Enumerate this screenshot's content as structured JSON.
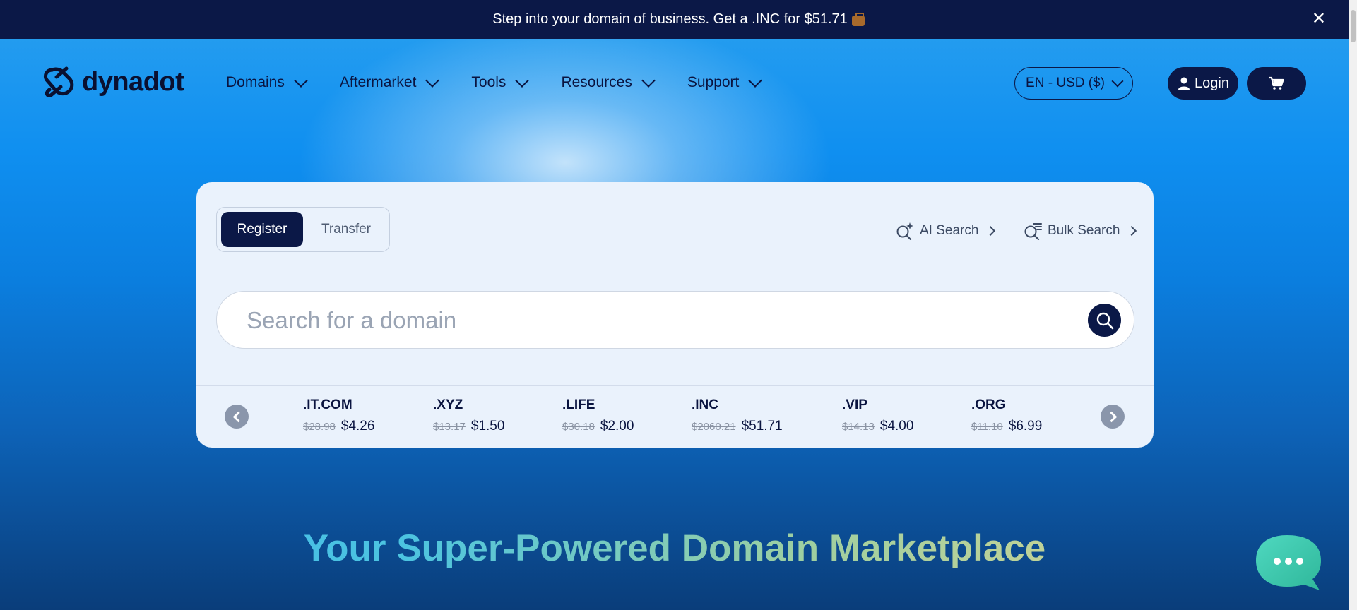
{
  "promo": {
    "text": "Step into your domain of business. Get a .INC for $51.71",
    "close_label": "✕"
  },
  "brand": {
    "name": "dynadot"
  },
  "nav": {
    "items": [
      "Domains",
      "Aftermarket",
      "Tools",
      "Resources",
      "Support"
    ]
  },
  "header": {
    "lang_label": "EN - USD ($)",
    "login_label": "Login"
  },
  "search": {
    "tabs": {
      "register": "Register",
      "transfer": "Transfer"
    },
    "ai_search_label": "AI Search",
    "bulk_search_label": "Bulk Search",
    "placeholder": "Search for a domain"
  },
  "tlds": [
    {
      "name": ".IT.COM",
      "old_price": "$28.98",
      "new_price": "$4.26"
    },
    {
      "name": ".XYZ",
      "old_price": "$13.17",
      "new_price": "$1.50"
    },
    {
      "name": ".LIFE",
      "old_price": "$30.18",
      "new_price": "$2.00"
    },
    {
      "name": ".INC",
      "old_price": "$2060.21",
      "new_price": "$51.71"
    },
    {
      "name": ".VIP",
      "old_price": "$14.13",
      "new_price": "$4.00"
    },
    {
      "name": ".ORG",
      "old_price": "$11.10",
      "new_price": "$6.99"
    }
  ],
  "hero": {
    "title": "Your Super-Powered Domain Marketplace"
  },
  "colors": {
    "navy": "#0b1847",
    "card": "#eaf2fc",
    "chat": "#3fcfb0"
  }
}
